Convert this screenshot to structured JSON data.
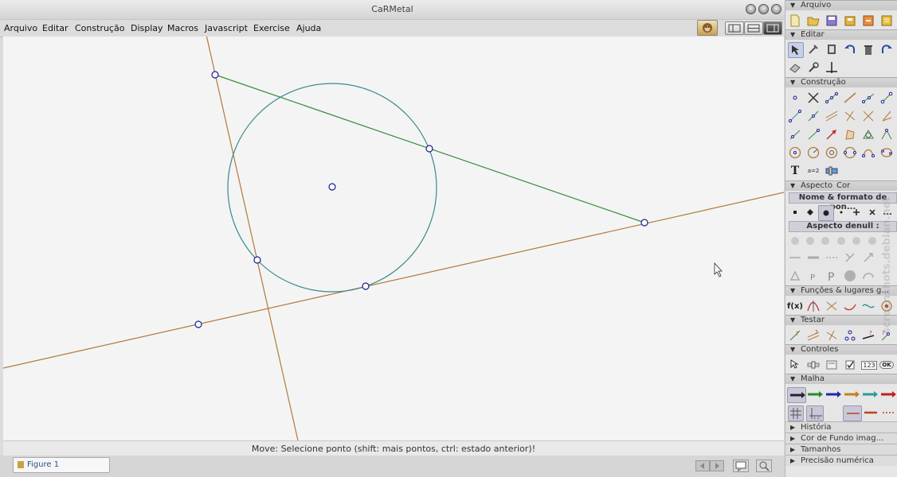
{
  "window": {
    "title": "CaRMetal"
  },
  "menu": [
    "Arquivo",
    "Editar",
    "Construção",
    "Display",
    "Macros",
    "Javascript",
    "Exercise",
    "Ajuda"
  ],
  "status": {
    "text": "Move: Selecione ponto (shift: mais pontos, ctrl: estado anterior)!"
  },
  "tab": {
    "label": "Figure 1"
  },
  "panel": {
    "sections": {
      "arquivo": "Arquivo",
      "editar": "Editar",
      "construcao": "Construção",
      "aspecto": "Aspecto",
      "cor": "Cor",
      "funcoes": "Funções & lugares g...",
      "testar": "Testar",
      "controles": "Controles",
      "malha": "Malha",
      "historia": "História",
      "cor_fundo": "Cor de Fundo   imag...",
      "tamanhos": "Tamanhos",
      "precisao": "Precisão numérica"
    },
    "aspect_name_label": "Nome & formato de pon...",
    "aspect_default_label": "Aspecto denull :",
    "control_numeric_label": "123",
    "control_ok_label": "OK",
    "fx_label": "f(x)",
    "text_tool_label": "T",
    "assign_tool_label": "a=2"
  },
  "watermark": "screenshots.debian.net",
  "colors": {
    "line_orange": "#b07a3a",
    "line_green": "#3a8a3a",
    "circle": "#3a8a8a",
    "point": "#1a1a9a"
  },
  "geometry_objects": {
    "circle": "circle",
    "center": "center point",
    "points": 7,
    "lines": 3
  }
}
